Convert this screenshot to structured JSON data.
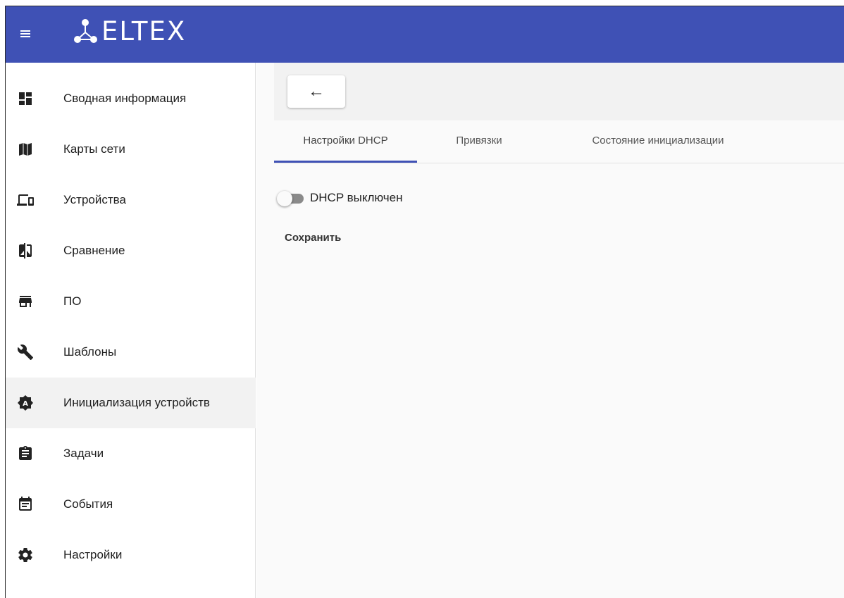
{
  "header": {
    "logo_text": "ELTEX",
    "brand_color": "#3f51b5",
    "menu_icon": "hamburger-menu-icon",
    "logo_icon": "eltex-logo-icon"
  },
  "sidebar": {
    "items": [
      {
        "label": "Сводная информация",
        "icon": "dashboard-icon",
        "active": false
      },
      {
        "label": "Карты сети",
        "icon": "map-icon",
        "active": false
      },
      {
        "label": "Устройства",
        "icon": "devices-icon",
        "active": false
      },
      {
        "label": "Сравнение",
        "icon": "compare-icon",
        "active": false
      },
      {
        "label": "ПО",
        "icon": "store-icon",
        "active": false
      },
      {
        "label": "Шаблоны",
        "icon": "wrench-icon",
        "active": false
      },
      {
        "label": "Инициализация устройств",
        "icon": "auto-init-icon",
        "active": true
      },
      {
        "label": "Задачи",
        "icon": "clipboard-icon",
        "active": false
      },
      {
        "label": "События",
        "icon": "event-icon",
        "active": false
      },
      {
        "label": "Настройки",
        "icon": "gear-icon",
        "active": false
      }
    ]
  },
  "main": {
    "back_label": "←",
    "tabs": [
      {
        "label": "Настройки DHCP",
        "active": true
      },
      {
        "label": "Привязки",
        "active": false
      },
      {
        "label": "Состояние инициализации",
        "active": false
      }
    ],
    "dhcp_toggle": {
      "label": "DHCP выключен",
      "on": false
    },
    "save_label": "Сохранить"
  }
}
